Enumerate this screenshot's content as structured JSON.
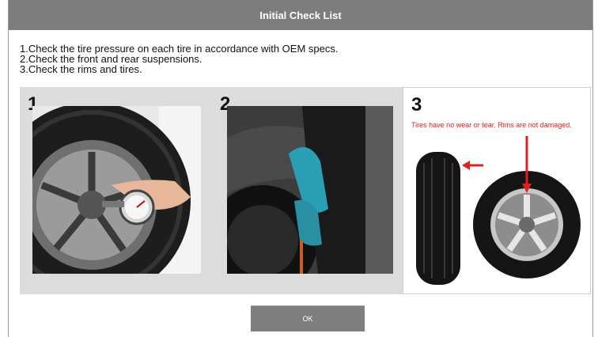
{
  "dialog": {
    "title": "Initial Check List",
    "instructions": [
      "1.Check the tire pressure on each tire in accordance with OEM specs.",
      "2.Check the front and rear suspensions.",
      "3.Check the rims and tires."
    ],
    "panels": [
      {
        "number": "1"
      },
      {
        "number": "2"
      },
      {
        "number": "3",
        "caption": "Tires have no wear or tear. Rims are not damaged."
      }
    ],
    "ok_label": "OK"
  }
}
